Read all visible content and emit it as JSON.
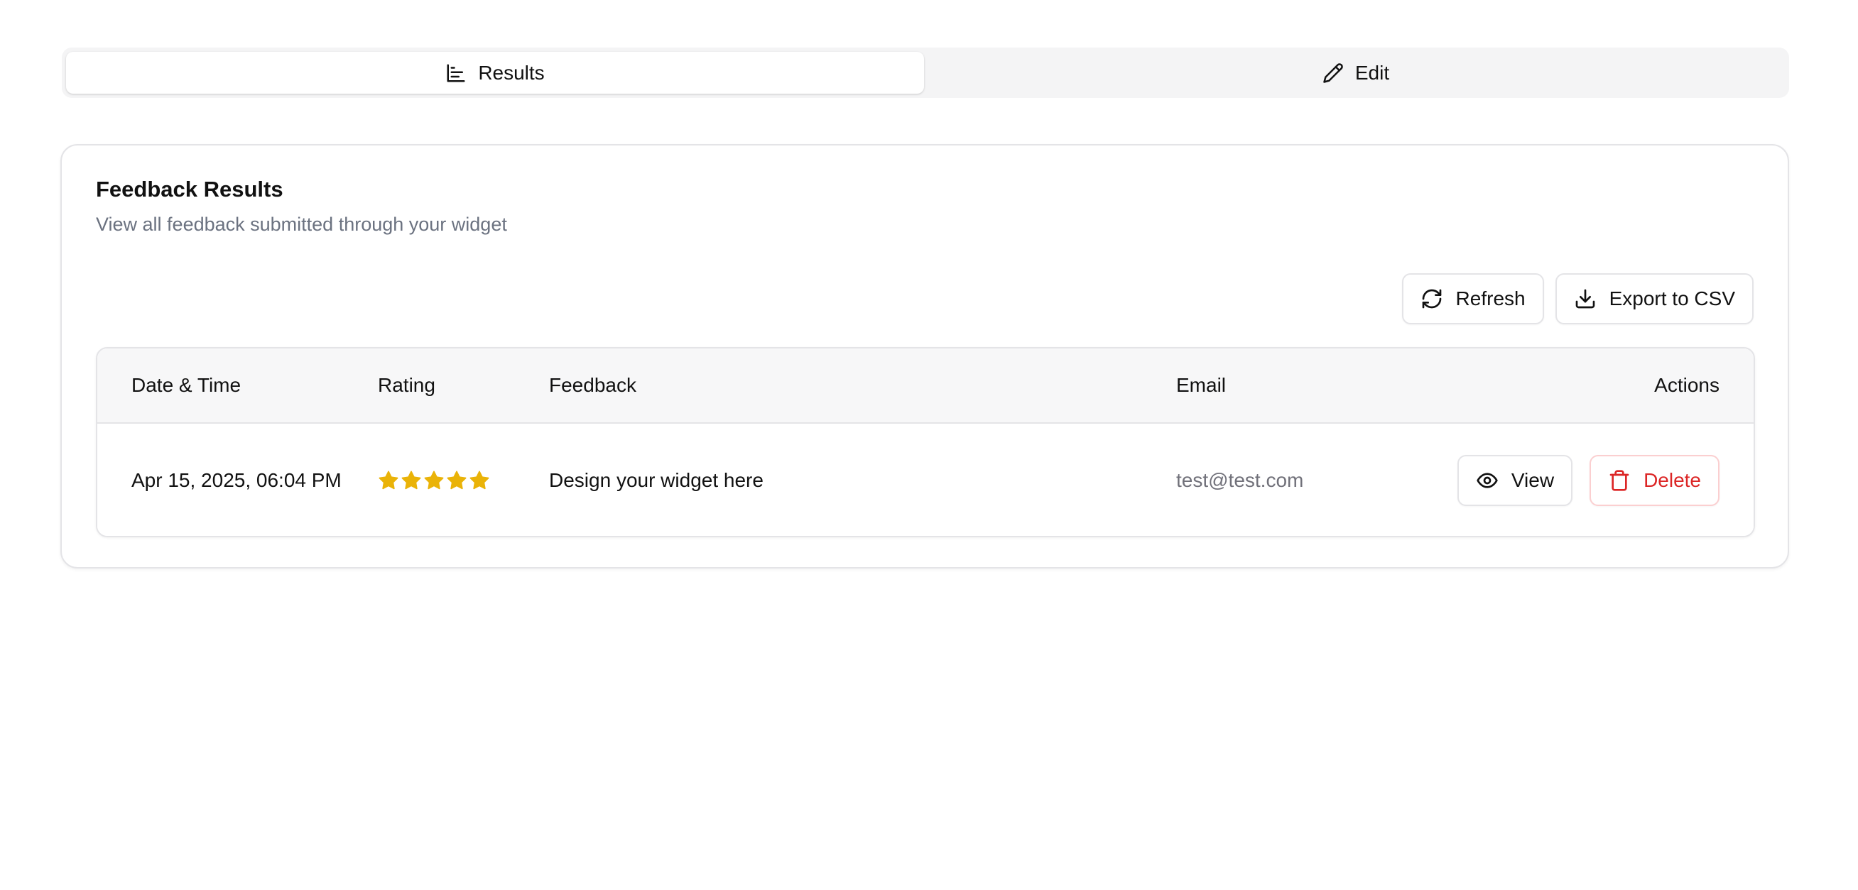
{
  "tabs": [
    {
      "label": "Results",
      "icon": "bar-chart-icon",
      "active": true
    },
    {
      "label": "Edit",
      "icon": "pencil-icon",
      "active": false
    }
  ],
  "card": {
    "title": "Feedback Results",
    "description": "View all feedback submitted through your widget"
  },
  "toolbar": {
    "refresh_label": "Refresh",
    "refresh_icon": "refresh-icon",
    "export_label": "Export to CSV",
    "export_icon": "download-icon"
  },
  "table": {
    "columns": [
      "Date & Time",
      "Rating",
      "Feedback",
      "Email",
      "Actions"
    ],
    "rows": [
      {
        "datetime": "Apr 15, 2025, 06:04 PM",
        "rating": 5,
        "rating_max": 5,
        "feedback": "Design your widget here",
        "email": "test@test.com",
        "view_label": "View",
        "delete_label": "Delete"
      }
    ]
  },
  "colors": {
    "star": "#eab308",
    "danger": "#dc2626",
    "muted_text": "#6b7280"
  }
}
